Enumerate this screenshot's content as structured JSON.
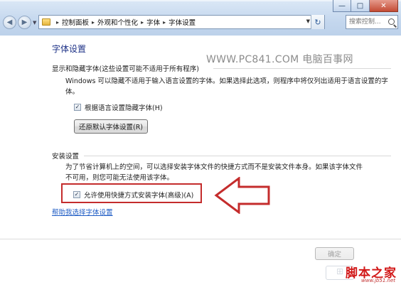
{
  "window": {
    "controls": {
      "minimize": "—",
      "maximize": "□",
      "close": "✕"
    }
  },
  "nav": {
    "back_icon": "back-arrow-icon",
    "forward_icon": "forward-arrow-icon",
    "history_icon": "chevron-down-icon"
  },
  "address_bar": {
    "icon": "folder-icon",
    "crumbs": [
      "控制面板",
      "外观和个性化",
      "字体",
      "字体设置"
    ],
    "refresh_icon": "refresh-icon"
  },
  "search": {
    "placeholder": "搜索控制...",
    "icon": "search-icon"
  },
  "page": {
    "title": "字体设置"
  },
  "watermark": "WWW.PC841.COM 电脑百事网",
  "display_group": {
    "header": "显示和隐藏字体(这些设置可能不适用于所有程序)",
    "description": "Windows 可以隐藏不适用于输入语言设置的字体。如果选择此选项，则程序中将仅列出适用于语言设置的字体。",
    "checkbox": {
      "label": "根据语言设置隐藏字体(H)",
      "checked": true
    },
    "restore_button": "还原默认字体设置(R)"
  },
  "install_group": {
    "header": "安装设置",
    "description": "为了节省计算机上的空间，可以选择安装字体文件的快捷方式而不是安装文件本身。如果该字体文件不可用，则您可能无法使用该字体。",
    "checkbox": {
      "label": "允许使用快捷方式安装字体(高级)(A)",
      "checked": true
    }
  },
  "help_link": "帮助我选择字体设置",
  "ok_button": "确定",
  "annotation": {
    "highlight_color": "#c42c2c",
    "arrow_color": "#c42c2c"
  },
  "logo": {
    "name": "脚本之家",
    "url": "www.jb51.net"
  },
  "colors": {
    "title_blue": "#1e3287",
    "link_blue": "#1d5bc4"
  }
}
